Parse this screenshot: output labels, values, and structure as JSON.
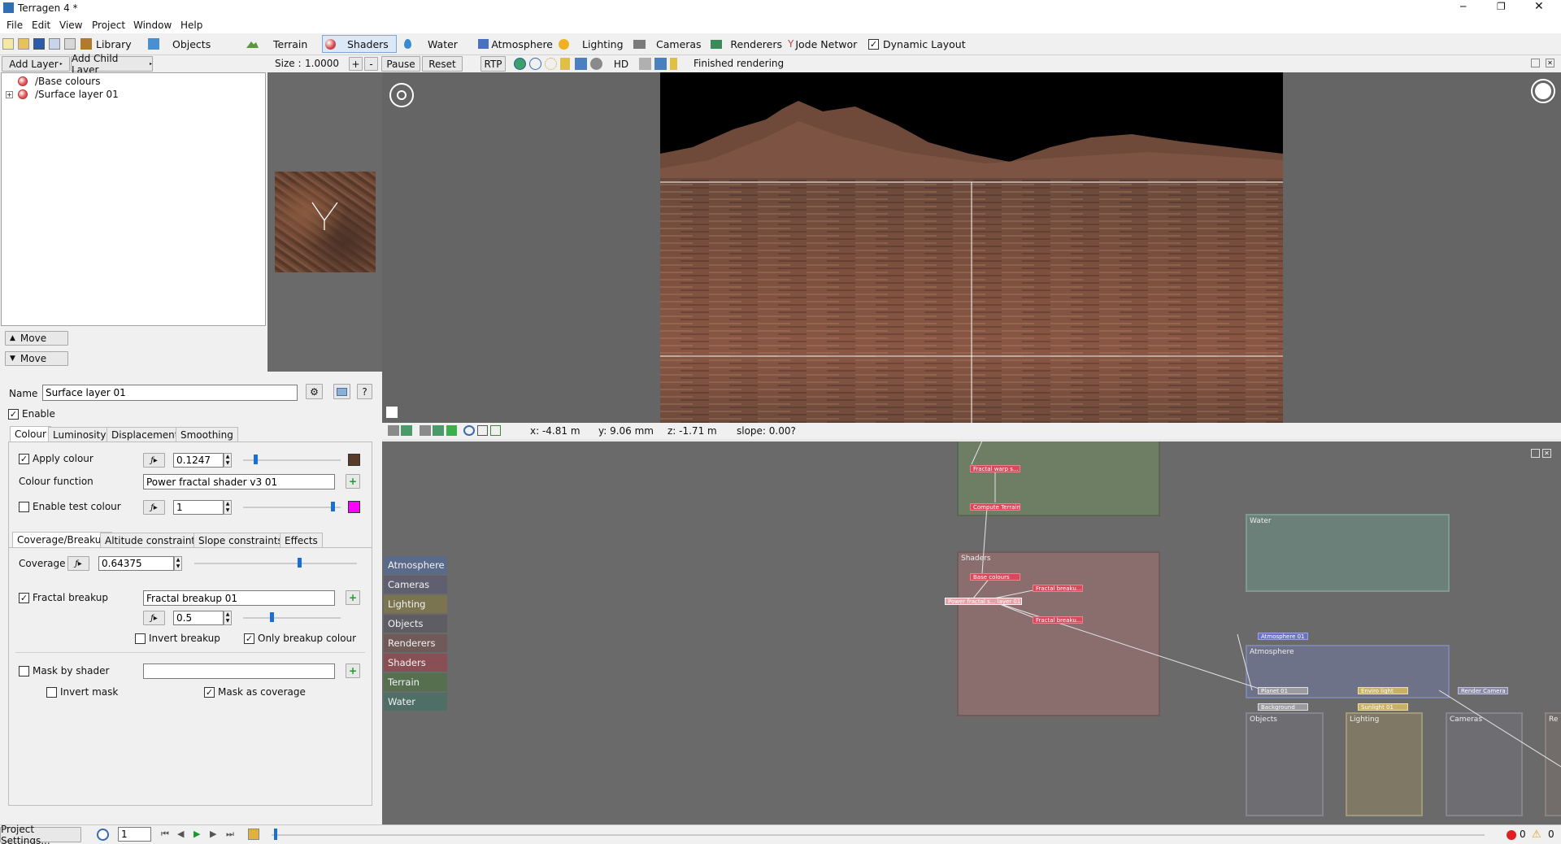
{
  "window": {
    "title": "Terragen 4 *",
    "controls": {
      "minimize": "─",
      "restore": "❐",
      "close": "✕"
    }
  },
  "menu": [
    "File",
    "Edit",
    "View",
    "Project",
    "Window",
    "Help"
  ],
  "toolbar": {
    "tabs": [
      {
        "label": "Library",
        "icon": "library-icon",
        "color": "#7a5a2a"
      },
      {
        "label": "Objects",
        "icon": "cube-icon",
        "color": "#4a8fd0"
      },
      {
        "label": "Terrain",
        "icon": "terrain-icon",
        "color": "#5a9a3a"
      },
      {
        "label": "Shaders",
        "icon": "shader-sphere-icon",
        "color": "#d04040"
      },
      {
        "label": "Water",
        "icon": "water-drop-icon",
        "color": "#3a8ad0"
      },
      {
        "label": "Atmosphere",
        "icon": "atmosphere-icon",
        "color": "#4a70c0"
      },
      {
        "label": "Lighting",
        "icon": "sun-icon",
        "color": "#e0a020"
      },
      {
        "label": "Cameras",
        "icon": "camera-icon",
        "color": "#707070"
      },
      {
        "label": "Renderers",
        "icon": "renderer-icon",
        "color": "#3a8a5a"
      },
      {
        "label": "Jode Networ",
        "icon": "node-network-icon",
        "color": "#c04040"
      }
    ],
    "active_tab": "Shaders",
    "dynamic_layout_label": "Dynamic Layout",
    "dynamic_layout_checked": true
  },
  "layer_panel": {
    "add_layer": "Add Layer",
    "add_child_layer": "Add Child Layer",
    "layers": [
      {
        "label": "/Base colours",
        "expandable": false
      },
      {
        "label": "/Surface layer 01",
        "expandable": true
      }
    ],
    "move_up": "Move",
    "move_down": "Move"
  },
  "render_toolbar": {
    "size_label": "Size :",
    "size_value": "1.0000",
    "plus": "+",
    "minus": "-",
    "pause": "Pause",
    "reset": "Reset",
    "rtp": "RTP",
    "hd": "HD",
    "status": "Finished rendering"
  },
  "readout": {
    "x": "x: -4.81 m",
    "y": "y: 9.06 mm",
    "z": "z: -1.71 m",
    "slope": "slope: 0.00?"
  },
  "properties": {
    "name_label": "Name",
    "name_value": "Surface layer 01",
    "enable_label": "Enable",
    "enable_checked": true,
    "tabs": [
      "Colour",
      "Luminosity",
      "Displacement",
      "Smoothing"
    ],
    "active_tab": "Colour",
    "apply_colour_label": "Apply colour",
    "apply_colour_checked": true,
    "apply_colour_value": "0.1247",
    "apply_colour_slider": 0.1247,
    "apply_colour_swatch": "#5a3a28",
    "colour_function_label": "Colour function",
    "colour_function_value": "Power fractal shader v3 01",
    "enable_test_colour_label": "Enable test colour",
    "enable_test_colour_checked": false,
    "test_colour_value": "1",
    "test_colour_slider": 1.0,
    "test_colour_swatch": "#ff00ff",
    "subtabs": [
      "Coverage/Breakup",
      "Altitude constraints",
      "Slope constraints",
      "Effects"
    ],
    "active_subtab": "Coverage/Breakup",
    "coverage_label": "Coverage",
    "coverage_value": "0.64375",
    "coverage_slider": 0.64375,
    "fractal_breakup_label": "Fractal breakup",
    "fractal_breakup_checked": true,
    "fractal_breakup_value": "Fractal breakup 01",
    "breakup_amount_value": "0.5",
    "breakup_amount_slider": 0.5,
    "invert_breakup_label": "Invert breakup",
    "invert_breakup_checked": false,
    "only_breakup_colour_label": "Only breakup colour",
    "only_breakup_colour_checked": true,
    "mask_by_shader_label": "Mask by shader",
    "mask_by_shader_checked": false,
    "mask_by_shader_value": "",
    "invert_mask_label": "Invert mask",
    "invert_mask_checked": false,
    "mask_as_coverage_label": "Mask as coverage",
    "mask_as_coverage_checked": true
  },
  "node_legend": [
    {
      "label": "Atmosphere",
      "color": "#5a6a8a"
    },
    {
      "label": "Cameras",
      "color": "#5f5f6f"
    },
    {
      "label": "Lighting",
      "color": "#7a7450"
    },
    {
      "label": "Objects",
      "color": "#5d5d63"
    },
    {
      "label": "Renderers",
      "color": "#6f5a58"
    },
    {
      "label": "Shaders",
      "color": "#8a4e55"
    },
    {
      "label": "Terrain",
      "color": "#56704f"
    },
    {
      "label": "Water",
      "color": "#4f6e66"
    }
  ],
  "node_network": {
    "groups": {
      "shaders": "Shaders",
      "water": "Water",
      "atmosphere": "Atmosphere",
      "objects": "Objects",
      "lighting": "Lighting",
      "cameras": "Cameras",
      "renderers": "Re"
    },
    "nodes": {
      "fractal_warp": "Fractal warp s...",
      "compute_terrain": "Compute Terrain",
      "base_colours": "Base colours",
      "fractal_breakup_a": "Fractal breaku...",
      "surface_layer": "Power fractal s... layer 01",
      "fractal_breakup_b": "Fractal breaku...",
      "atmosphere": "Atmosphere 01",
      "planet": "Planet 01",
      "background": "Background",
      "enviro_light": "Enviro light",
      "sunlight": "Sunlight 01",
      "render_camera": "Render Camera"
    }
  },
  "timeline": {
    "project_settings": "Project Settings...",
    "frame": "1",
    "errors": "0",
    "warnings": "0"
  }
}
